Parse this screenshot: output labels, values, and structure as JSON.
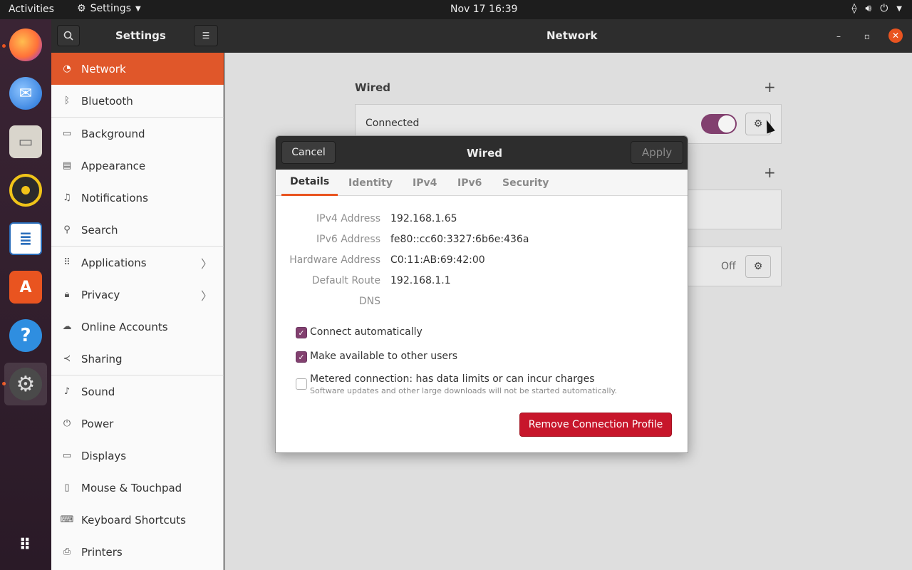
{
  "topbar": {
    "activities": "Activities",
    "app_menu": "Settings",
    "clock": "Nov 17  16:39"
  },
  "dock": {
    "items": [
      "Firefox",
      "Thunderbird",
      "Files",
      "Rhythmbox",
      "LibreOffice Writer",
      "Ubuntu Software",
      "Help",
      "Settings"
    ]
  },
  "header": {
    "title": "Settings",
    "pane_title": "Network"
  },
  "sidebar": {
    "items": [
      {
        "label": "Network",
        "icon": "network-icon"
      },
      {
        "label": "Bluetooth",
        "icon": "bluetooth-icon"
      },
      {
        "label": "Background",
        "icon": "background-icon"
      },
      {
        "label": "Appearance",
        "icon": "appearance-icon"
      },
      {
        "label": "Notifications",
        "icon": "bell-icon"
      },
      {
        "label": "Search",
        "icon": "search-icon"
      },
      {
        "label": "Applications",
        "icon": "grid-icon"
      },
      {
        "label": "Privacy",
        "icon": "lock-icon"
      },
      {
        "label": "Online Accounts",
        "icon": "cloud-icon"
      },
      {
        "label": "Sharing",
        "icon": "share-icon"
      },
      {
        "label": "Sound",
        "icon": "music-icon"
      },
      {
        "label": "Power",
        "icon": "power-icon"
      },
      {
        "label": "Displays",
        "icon": "display-icon"
      },
      {
        "label": "Mouse & Touchpad",
        "icon": "mouse-icon"
      },
      {
        "label": "Keyboard Shortcuts",
        "icon": "keyboard-icon"
      },
      {
        "label": "Printers",
        "icon": "printer-icon"
      }
    ]
  },
  "main": {
    "wired_title": "Wired",
    "wired_status": "Connected",
    "proxy_status": "Off"
  },
  "dialog": {
    "cancel": "Cancel",
    "title": "Wired",
    "apply": "Apply",
    "tabs": [
      "Details",
      "Identity",
      "IPv4",
      "IPv6",
      "Security"
    ],
    "details": {
      "ipv4_label": "IPv4 Address",
      "ipv4_value": "192.168.1.65",
      "ipv6_label": "IPv6 Address",
      "ipv6_value": "fe80::cc60:3327:6b6e:436a",
      "hw_label": "Hardware Address",
      "hw_value": "C0:11:AB:69:42:00",
      "route_label": "Default Route",
      "route_value": "192.168.1.1",
      "dns_label": "DNS"
    },
    "checks": {
      "auto": "Connect automatically",
      "others": "Make available to other users",
      "metered": "Metered connection: has data limits or can incur charges",
      "metered_sub": "Software updates and other large downloads will not be started automatically."
    },
    "remove": "Remove Connection Profile"
  },
  "colors": {
    "accent": "#e95420",
    "toggle": "#82406f",
    "danger": "#c7162b"
  }
}
